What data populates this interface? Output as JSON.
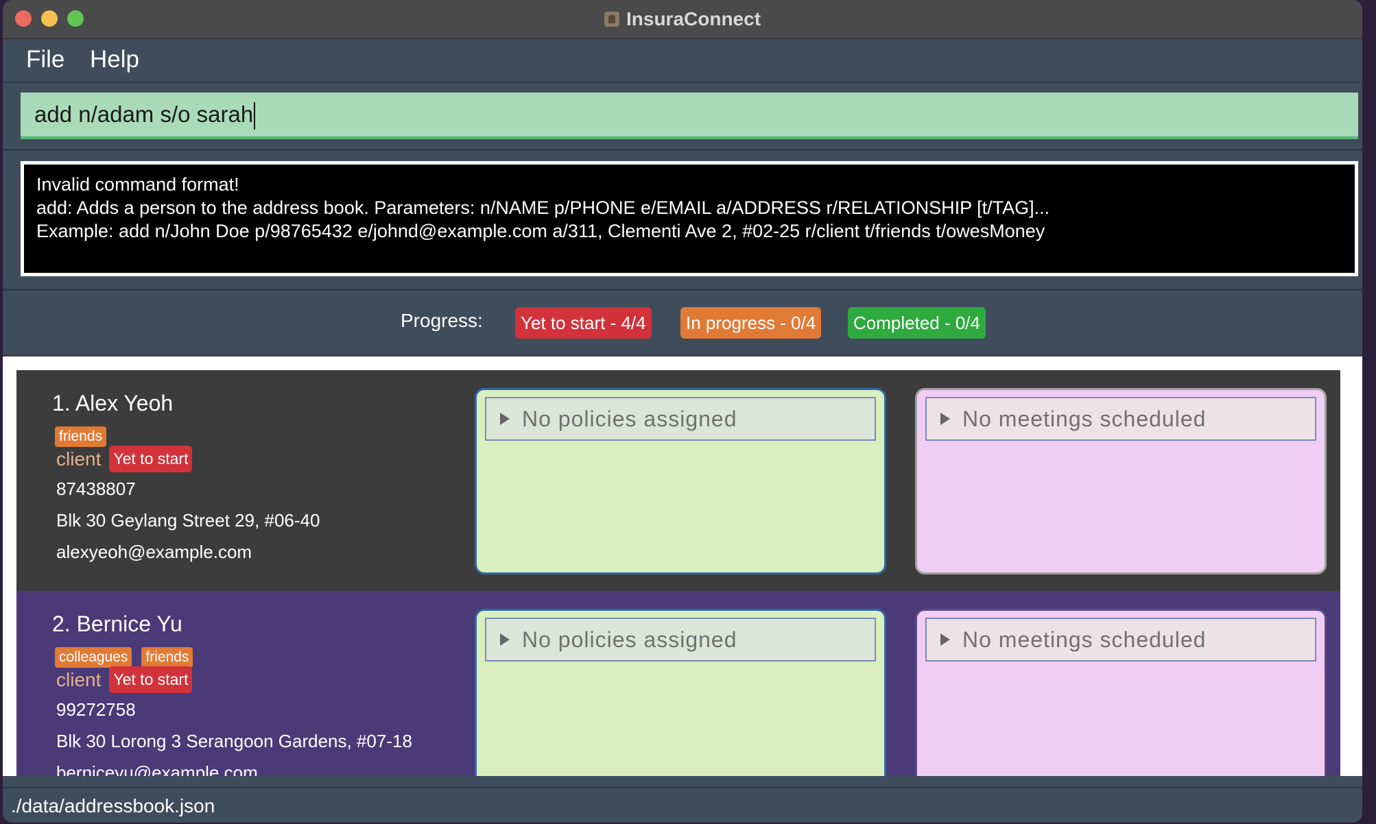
{
  "window": {
    "title": "InsuraConnect"
  },
  "menu": {
    "file": "File",
    "help": "Help"
  },
  "command": {
    "value": "add n/adam s/o sarah"
  },
  "result": {
    "lines": [
      "Invalid command format!",
      "add: Adds a person to the address book. Parameters: n/NAME p/PHONE e/EMAIL a/ADDRESS r/RELATIONSHIP [t/TAG]...",
      "Example: add n/John Doe p/98765432 e/johnd@example.com a/311, Clementi Ave 2, #02-25 r/client t/friends t/owesMoney"
    ]
  },
  "progress": {
    "label": "Progress:",
    "yet": "Yet to start - 4/4",
    "in_progress": "In progress - 0/4",
    "completed": "Completed - 0/4"
  },
  "persons": [
    {
      "name": "1.  Alex Yeoh",
      "tags": [
        "friends"
      ],
      "relationship": "client",
      "status": "Yet to start",
      "phone": "87438807",
      "address": "Blk 30 Geylang Street 29, #06-40",
      "email": "alexyeoh@example.com",
      "policies": "No policies assigned",
      "meetings": "No meetings scheduled"
    },
    {
      "name": "2.  Bernice Yu",
      "tags": [
        "colleagues",
        "friends"
      ],
      "relationship": "client",
      "status": "Yet to start",
      "phone": "99272758",
      "address": "Blk 30 Lorong 3 Serangoon Gardens, #07-18",
      "email": "berniceyu@example.com",
      "policies": "No policies assigned",
      "meetings": "No meetings scheduled"
    }
  ],
  "status_bar": {
    "path": "./data/addressbook.json"
  },
  "colors": {
    "tag": "#e07b36",
    "status_yet": "#d2323a",
    "status_in_progress": "#e07b36",
    "status_completed": "#2eaa3e",
    "command_bg": "#a9dbb8",
    "policy_bg": "#d9efc0",
    "meeting_bg": "#f0cdf2"
  }
}
